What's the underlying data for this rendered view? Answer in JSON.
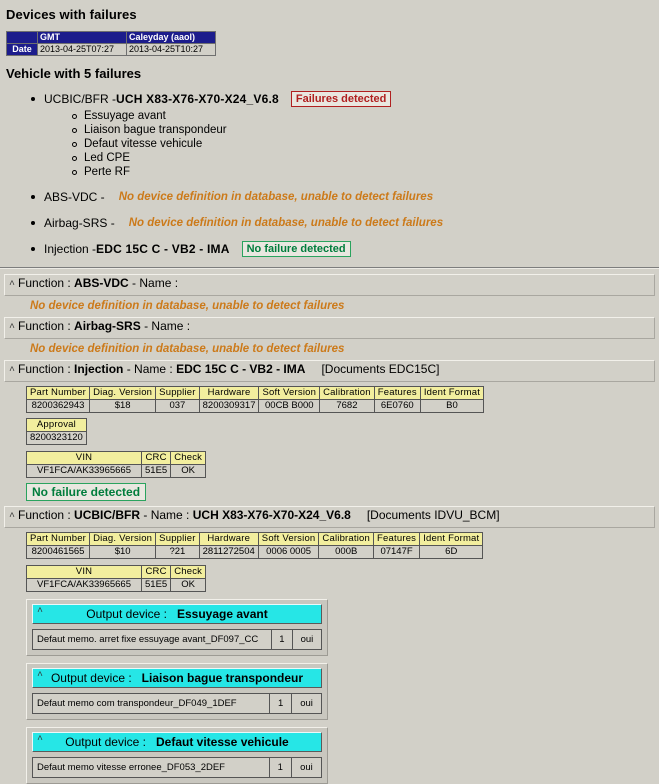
{
  "page": {
    "heading": "Devices with failures",
    "vehicle_heading": "Vehicle with 5 failures"
  },
  "date_table": {
    "corner": "",
    "col_gmt": "GMT",
    "col_local": "Caleyday (aaol)",
    "row_label": "Date",
    "gmt_value": "2013-04-25T07:27",
    "local_value": "2013-04-25T10:27"
  },
  "devices": [
    {
      "function": "UCBIC/BFR - ",
      "name": "UCH X83-X76-X70-X24_V6.8",
      "status": "Failures detected",
      "status_type": "fail",
      "failures": [
        "Essuyage avant",
        "Liaison bague transpondeur",
        "Defaut vitesse vehicule",
        "Led CPE",
        "Perte RF"
      ]
    },
    {
      "function": "ABS-VDC - ",
      "name": "",
      "message": "No device definition in database, unable to detect failures",
      "status_type": "nodef",
      "failures": []
    },
    {
      "function": "Airbag-SRS - ",
      "name": "",
      "message": "No device definition in database, unable to detect failures",
      "status_type": "nodef",
      "failures": []
    },
    {
      "function": "Injection - ",
      "name": "EDC 15C C - VB2 - IMA",
      "status": "No failure detected",
      "status_type": "ok",
      "failures": []
    }
  ],
  "sections": [
    {
      "caret": "^",
      "prefix": "Function : ",
      "function": "ABS-VDC",
      "mid": " - Name : ",
      "name": "",
      "docs": "",
      "message": "No device definition in database, unable to detect failures"
    },
    {
      "caret": "^",
      "prefix": "Function : ",
      "function": "Airbag-SRS",
      "mid": " - Name : ",
      "name": "",
      "docs": "",
      "message": "No device definition in database, unable to detect failures"
    },
    {
      "caret": "^",
      "prefix": "Function : ",
      "function": "Injection",
      "mid": " - Name : ",
      "name": "EDC 15C C - VB2 - IMA",
      "docs": "[Documents EDC15C]",
      "message": ""
    },
    {
      "caret": "^",
      "prefix": "Function : ",
      "function": "UCBIC/BFR",
      "mid": " - Name : ",
      "name": "UCH X83-X76-X70-X24_V6.8",
      "docs": "[Documents IDVU_BCM]",
      "message": ""
    }
  ],
  "param_headers": [
    "Part Number",
    "Diag. Version",
    "Supplier",
    "Hardware",
    "Soft Version",
    "Calibration",
    "Features",
    "Ident Format"
  ],
  "injection_params": [
    "8200362943",
    "$18",
    "037",
    "8200309317",
    "00CB   B000",
    "7682",
    "6E0760",
    "B0"
  ],
  "ucbic_params": [
    "8200461565",
    "$10",
    "?21",
    "2811272504",
    "0006   0005",
    "000B",
    "07147F",
    "6D"
  ],
  "approval": {
    "header": "Approval",
    "value": "8200323120"
  },
  "vin_headers": [
    "VIN",
    "CRC",
    "Check"
  ],
  "injection_vin": [
    "VF1FCA/AK33965665",
    "51E5",
    "OK"
  ],
  "ucbic_vin": [
    "VF1FCA/AK33965665",
    "51E5",
    "OK"
  ],
  "injection_status": "No failure detected",
  "output_devices": [
    {
      "caret": "^",
      "label": "Output device :",
      "name": "Essuyage avant",
      "rows": [
        {
          "desc": "Defaut memo. arret fixe essuyage avant_DF097_CC",
          "count": "1",
          "flag": "oui"
        }
      ]
    },
    {
      "caret": "^",
      "label": "Output device :",
      "name": "Liaison bague transpondeur",
      "rows": [
        {
          "desc": "Defaut memo com transpondeur_DF049_1DEF",
          "count": "1",
          "flag": "oui"
        }
      ]
    },
    {
      "caret": "^",
      "label": "Output device :",
      "name": "Defaut vitesse vehicule",
      "rows": [
        {
          "desc": "Defaut memo vitesse erronee_DF053_2DEF",
          "count": "1",
          "flag": "oui"
        }
      ]
    }
  ],
  "colors": {
    "background": "#d2d0c8",
    "header_blue": "#1c1c8c",
    "table_header_yellow": "#f2ee9e",
    "output_cyan": "#26e6e6",
    "fail_red": "#b02020",
    "ok_green": "#007d3c",
    "warn_orange": "#cc7a1a"
  }
}
